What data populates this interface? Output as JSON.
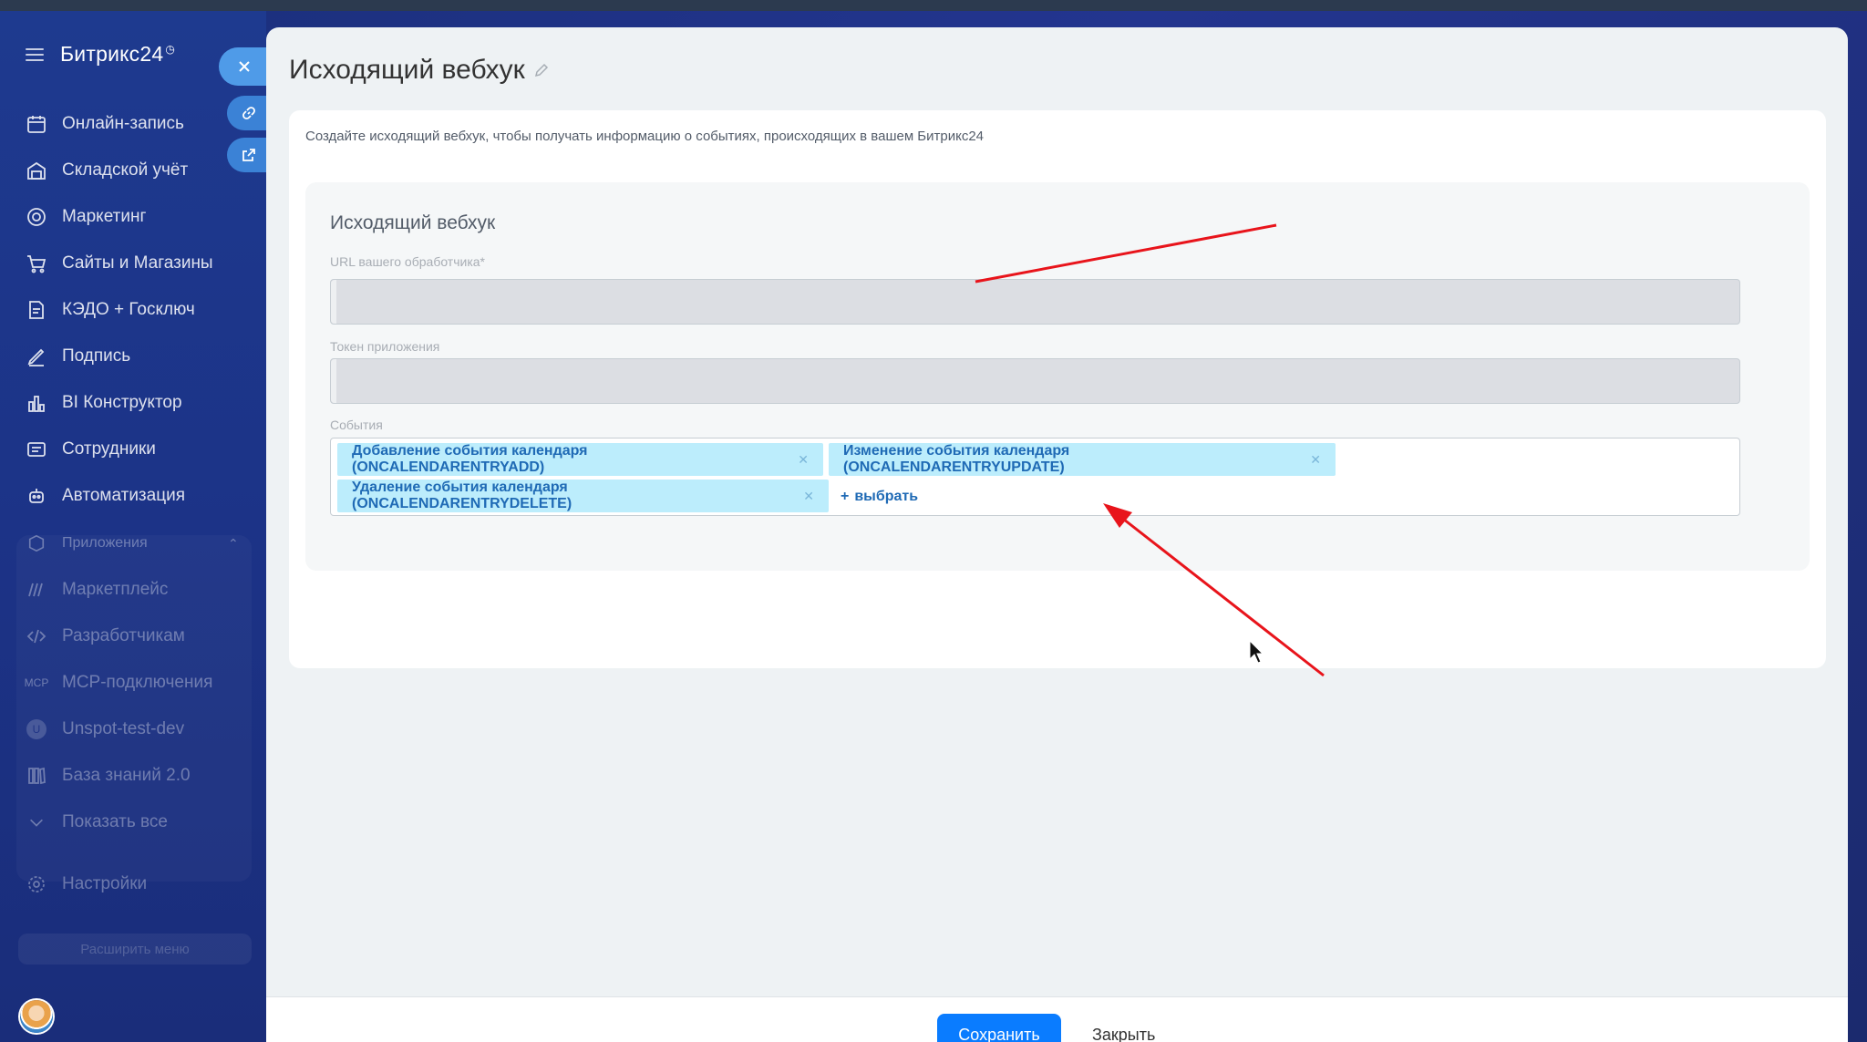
{
  "app": {
    "logo": "Битрикс24"
  },
  "sidebar": {
    "items": [
      {
        "label": "Онлайн-запись",
        "icon": "calendar-icon"
      },
      {
        "label": "Складской учёт",
        "icon": "warehouse-icon"
      },
      {
        "label": "Маркетинг",
        "icon": "target-icon"
      },
      {
        "label": "Сайты и Магазины",
        "icon": "cart-icon"
      },
      {
        "label": "КЭДО + Госключ",
        "icon": "document-icon"
      },
      {
        "label": "Подпись",
        "icon": "signature-icon"
      },
      {
        "label": "BI Конструктор",
        "icon": "bar-chart-icon"
      },
      {
        "label": "Сотрудники",
        "icon": "id-card-icon"
      },
      {
        "label": "Автоматизация",
        "icon": "robot-icon"
      }
    ],
    "apps_label": "Приложения",
    "apps_items": [
      {
        "label": "Маркетплейс",
        "icon": "market-icon"
      },
      {
        "label": "Разработчикам",
        "icon": "code-icon"
      },
      {
        "label": "MCP-подключения",
        "icon": "mcp-icon"
      },
      {
        "label": "Unspot-test-dev",
        "icon": "app-avatar-icon",
        "avatar_letter": "U"
      },
      {
        "label": "База знаний 2.0",
        "icon": "book-icon"
      }
    ],
    "show_all": "Показать все",
    "settings": "Настройки",
    "expand": "Расширить меню"
  },
  "slider": {
    "title": "Исходящий вебхук",
    "description": "Создайте исходящий вебхук, чтобы получать информацию о событиях, происходящих в вашем Битрикс24",
    "section_title": "Исходящий вебхук",
    "url_label": "URL вашего обработчика*",
    "url_value": "",
    "token_label": "Токен приложения",
    "token_value": "",
    "events_label": "События",
    "events": [
      "Добавление события календаря (ONCALENDARENTRYADD)",
      "Изменение события календаря (ONCALENDARENTRYUPDATE)",
      "Удаление события календаря (ONCALENDARENTRYDELETE)"
    ],
    "add_label": "выбрать"
  },
  "footer": {
    "save": "Сохранить",
    "close": "Закрыть"
  },
  "colors": {
    "accent": "#0a7cff",
    "tag_bg": "#bcedfc",
    "tag_text": "#1f6ab5",
    "annotation": "#e8141b"
  }
}
